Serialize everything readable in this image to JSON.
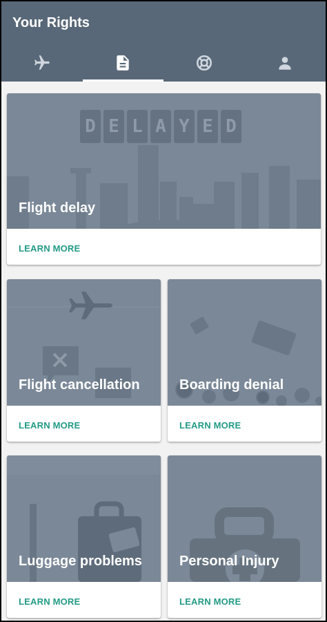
{
  "appbar": {
    "title": "Your Rights",
    "tabs": [
      {
        "icon": "airplane-icon",
        "active": false
      },
      {
        "icon": "document-icon",
        "active": true
      },
      {
        "icon": "lifebuoy-icon",
        "active": false
      },
      {
        "icon": "person-icon",
        "active": false
      }
    ]
  },
  "cards": [
    {
      "title": "Flight delay",
      "action": "LEARN MORE",
      "board_letters": [
        "D",
        "E",
        "L",
        "A",
        "Y",
        "E",
        "D"
      ]
    },
    {
      "title": "Flight cancellation",
      "action": "LEARN MORE"
    },
    {
      "title": "Boarding denial",
      "action": "LEARN MORE"
    },
    {
      "title": "Luggage problems",
      "action": "LEARN MORE"
    },
    {
      "title": "Personal Injury",
      "action": "LEARN MORE"
    }
  ],
  "colors": {
    "appbar": "#596878",
    "card_media": "#7b8898",
    "accent": "#239a86"
  }
}
